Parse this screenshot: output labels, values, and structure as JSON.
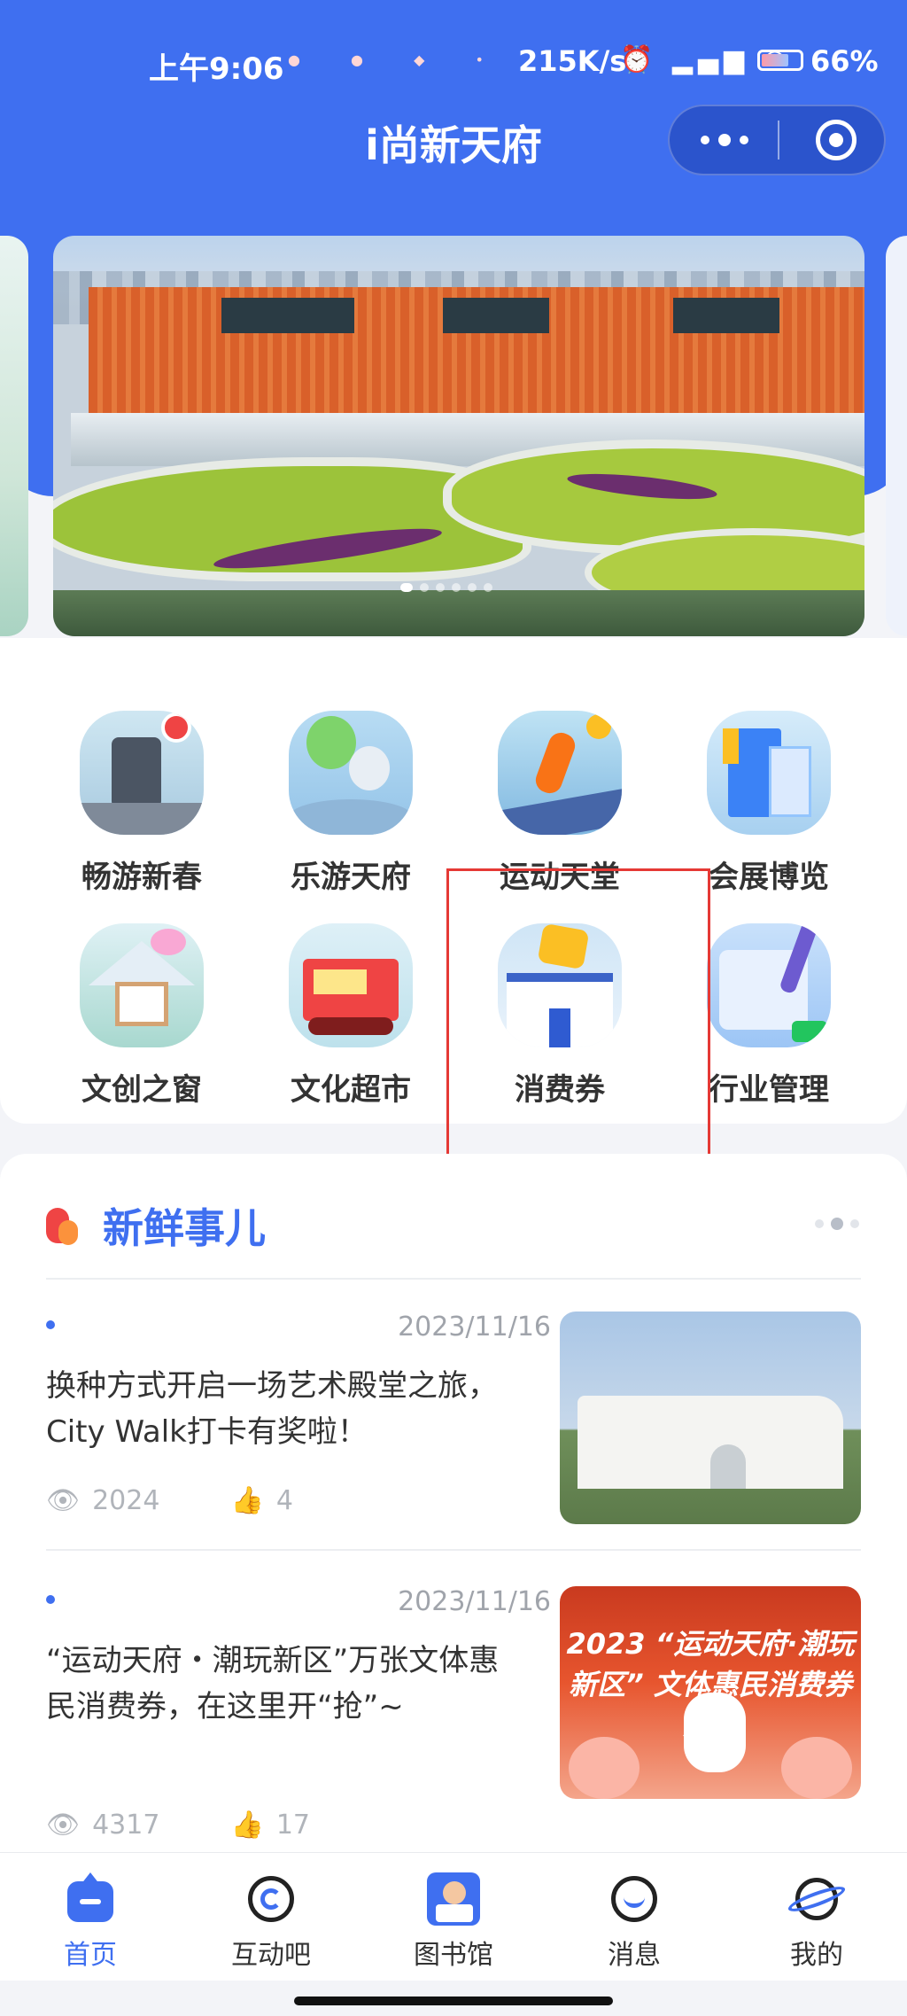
{
  "status_bar": {
    "time": "上午9:06",
    "network_speed": "215K/s",
    "icons": "⏰ ▂▄▆ ◠",
    "battery": "66%"
  },
  "nav": {
    "title": "i尚新天府"
  },
  "banner": {
    "page_count": 6,
    "active_page": 1
  },
  "grid": {
    "items": [
      {
        "label": "畅游新春",
        "icon": "city-sign-icon"
      },
      {
        "label": "乐游天府",
        "icon": "balloon-icon"
      },
      {
        "label": "运动天堂",
        "icon": "runner-icon"
      },
      {
        "label": "会展博览",
        "icon": "building-icon"
      },
      {
        "label": "文创之窗",
        "icon": "easel-icon"
      },
      {
        "label": "文化超市",
        "icon": "shop-truck-icon"
      },
      {
        "label": "消费券",
        "icon": "coupon-store-icon"
      },
      {
        "label": "行业管理",
        "icon": "pen-form-icon"
      }
    ]
  },
  "news": {
    "title": "新鲜事儿",
    "pager_count": 3,
    "items": [
      {
        "date": "2023/11/16",
        "text": "换种方式开启一场艺术殿堂之旅，City Walk打卡有奖啦！",
        "views": "2024",
        "likes": "4"
      },
      {
        "date": "2023/11/16",
        "text": "“运动天府・潮玩新区”万张文体惠民消费券，在这里开“抢”~",
        "views": "4317",
        "likes": "17",
        "image_text": "2023 “运动天府·潮玩新区” 文体惠民消费券活动"
      }
    ]
  },
  "tabbar": {
    "tabs": [
      {
        "label": "首页",
        "icon": "home-icon"
      },
      {
        "label": "互动吧",
        "icon": "interact-ring-icon"
      },
      {
        "label": "图书馆",
        "icon": "library-icon"
      },
      {
        "label": "消息",
        "icon": "message-smile-icon"
      },
      {
        "label": "我的",
        "icon": "planet-icon"
      }
    ]
  },
  "colors": {
    "brand": "#3f6ff0",
    "highlight_box": "#e53935"
  }
}
